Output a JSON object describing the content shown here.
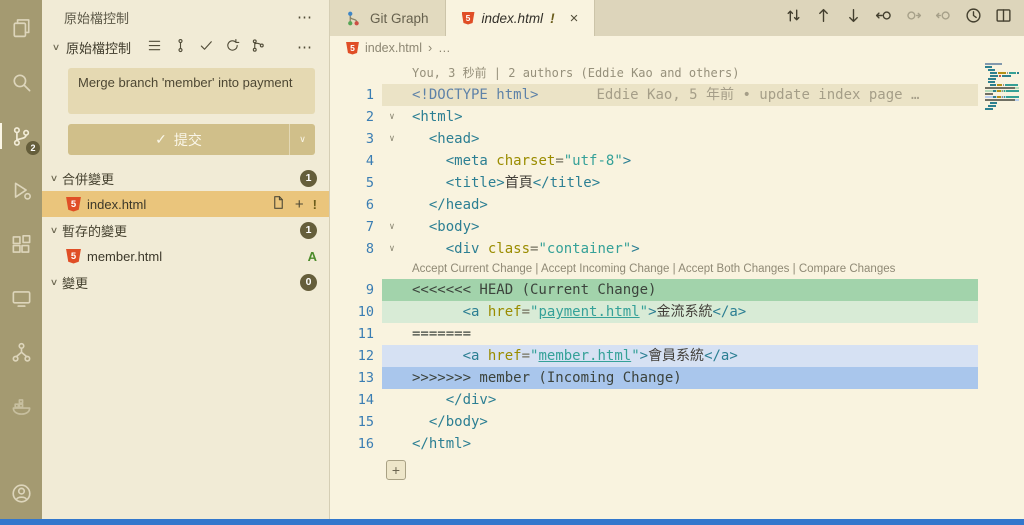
{
  "glyphs": {
    "more": "⋯",
    "chevron_down": "∨",
    "check": "✓",
    "close": "×",
    "plus": "+",
    "breadcrumb_sep": "›",
    "html5": "5"
  },
  "activity_bar": {
    "scm_badge": "2",
    "items": [
      "explorer",
      "search",
      "source-control",
      "run-debug",
      "extensions",
      "remote-explorer",
      "project-tree",
      "docker",
      "accounts"
    ]
  },
  "sidebar": {
    "title": "原始檔控制",
    "panel_label": "原始檔控制",
    "commit_input": "Merge branch 'member' into payment",
    "commit_button": "提交",
    "groups": [
      {
        "label": "合併變更",
        "badge": "1",
        "items": [
          {
            "name": "index.html",
            "status": "!"
          }
        ]
      },
      {
        "label": "暫存的變更",
        "badge": "1",
        "items": [
          {
            "name": "member.html",
            "status": "A"
          }
        ]
      },
      {
        "label": "變更",
        "badge": "0",
        "items": []
      }
    ]
  },
  "editor": {
    "tabs": [
      {
        "label": "Git Graph"
      },
      {
        "label": "index.html",
        "flag": "!",
        "active": true
      }
    ],
    "breadcrumb": {
      "file": "index.html",
      "more": "…"
    },
    "blame_header": "You, 3 秒前 | 2 authors (Eddie Kao and others)",
    "codelens_actions": [
      "Accept Current Change",
      "Accept Incoming Change",
      "Accept Both Changes",
      "Compare Changes"
    ],
    "code_lines": [
      {
        "n": 1,
        "hl": "hl-blame",
        "blame": "Eddie Kao, 5 年前 • update index page …",
        "seg": [
          [
            "<!DOCTYPE html>",
            "doctype"
          ]
        ]
      },
      {
        "n": 2,
        "fold": true,
        "seg": [
          [
            "<html>",
            "tag"
          ]
        ]
      },
      {
        "n": 3,
        "fold": true,
        "seg": [
          [
            "  ",
            "plain"
          ],
          [
            "<head>",
            "tag"
          ]
        ]
      },
      {
        "n": 4,
        "seg": [
          [
            "    ",
            "plain"
          ],
          [
            "<meta ",
            "tag"
          ],
          [
            "charset",
            "attr"
          ],
          [
            "=",
            "op"
          ],
          [
            "\"utf-8\"",
            "str"
          ],
          [
            ">",
            "tag"
          ]
        ]
      },
      {
        "n": 5,
        "seg": [
          [
            "    ",
            "plain"
          ],
          [
            "<title>",
            "tag"
          ],
          [
            "首頁",
            "text"
          ],
          [
            "</title>",
            "tag"
          ]
        ]
      },
      {
        "n": 6,
        "seg": [
          [
            "  ",
            "plain"
          ],
          [
            "</head>",
            "tag"
          ]
        ]
      },
      {
        "n": 7,
        "fold": true,
        "seg": [
          [
            "  ",
            "plain"
          ],
          [
            "<body>",
            "tag"
          ]
        ]
      },
      {
        "n": 8,
        "fold": true,
        "seg": [
          [
            "    ",
            "plain"
          ],
          [
            "<div ",
            "tag"
          ],
          [
            "class",
            "attr"
          ],
          [
            "=",
            "op"
          ],
          [
            "\"container\"",
            "str"
          ],
          [
            ">",
            "tag"
          ]
        ]
      },
      {
        "n": 9,
        "lens": true,
        "hl": "hl-cur-head",
        "seg": [
          [
            "<<<<<<< HEAD (Current Change)",
            "marker"
          ]
        ]
      },
      {
        "n": 10,
        "hl": "hl-cur",
        "seg": [
          [
            "      ",
            "plain"
          ],
          [
            "<a ",
            "tag"
          ],
          [
            "href",
            "attr"
          ],
          [
            "=",
            "op"
          ],
          [
            "\"",
            "str"
          ],
          [
            "payment.html",
            "strlink"
          ],
          [
            "\"",
            "str"
          ],
          [
            ">",
            "tag"
          ],
          [
            "金流系統",
            "text"
          ],
          [
            "</a>",
            "tag"
          ]
        ]
      },
      {
        "n": 11,
        "seg": [
          [
            "=======",
            "marker"
          ]
        ]
      },
      {
        "n": 12,
        "hl": "hl-inc",
        "seg": [
          [
            "      ",
            "plain"
          ],
          [
            "<a ",
            "tag"
          ],
          [
            "href",
            "attr"
          ],
          [
            "=",
            "op"
          ],
          [
            "\"",
            "str"
          ],
          [
            "member.html",
            "strlink"
          ],
          [
            "\"",
            "str"
          ],
          [
            ">",
            "tag"
          ],
          [
            "會員系統",
            "text"
          ],
          [
            "</a>",
            "tag"
          ]
        ]
      },
      {
        "n": 13,
        "hl": "hl-inc-head",
        "seg": [
          [
            ">>>>>>> member (Incoming Change)",
            "marker"
          ]
        ]
      },
      {
        "n": 14,
        "seg": [
          [
            "    ",
            "plain"
          ],
          [
            "</div>",
            "tag"
          ]
        ]
      },
      {
        "n": 15,
        "seg": [
          [
            "  ",
            "plain"
          ],
          [
            "</body>",
            "tag"
          ]
        ]
      },
      {
        "n": 16,
        "seg": [
          [
            "</html>",
            "tag"
          ]
        ]
      }
    ]
  },
  "colors": {
    "activity_bar": "#a49a71",
    "sidebar_bg": "#f1ebd6",
    "editor_bg": "#f9f3df",
    "selection": "#eac57c",
    "status_bar": "#3277cc",
    "conflict_current": "#a2d3ab",
    "conflict_incoming": "#a9c6ec",
    "html_icon": "#e04e26"
  }
}
